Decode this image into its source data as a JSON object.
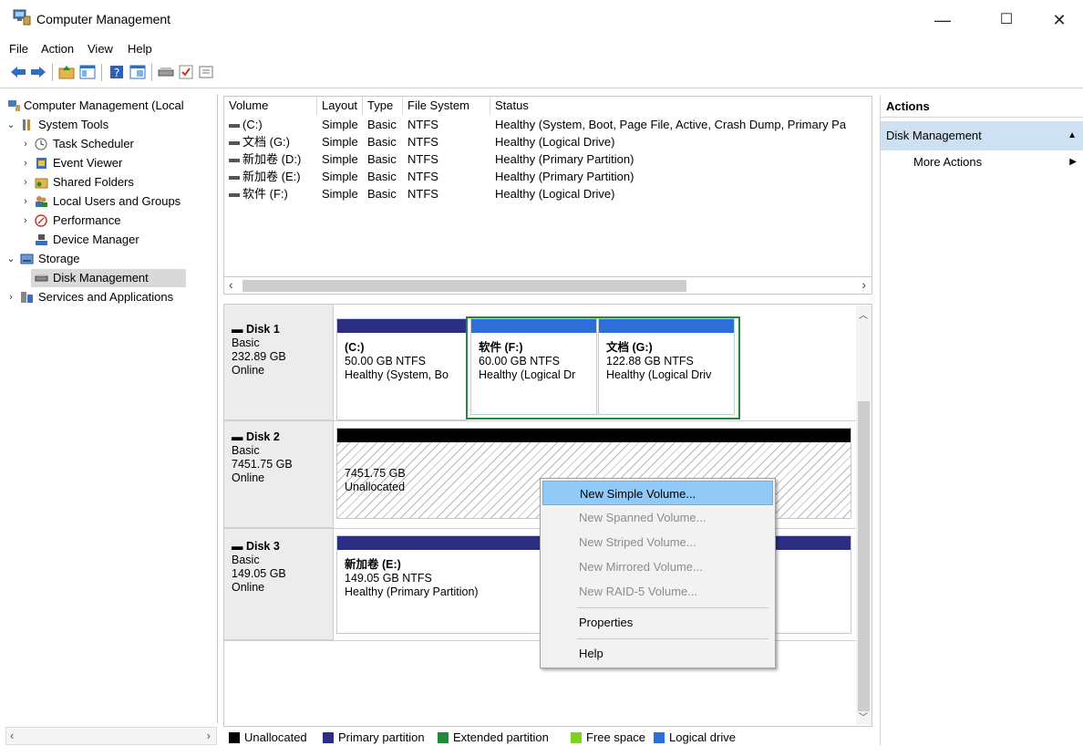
{
  "window": {
    "title": "Computer Management",
    "controls": {
      "minimize": "—",
      "maximize": "☐",
      "close": "✕"
    }
  },
  "menu": [
    "File",
    "Action",
    "View",
    "Help"
  ],
  "tree": {
    "root": "Computer Management (Local",
    "system_tools": "System Tools",
    "task_scheduler": "Task Scheduler",
    "event_viewer": "Event Viewer",
    "shared_folders": "Shared Folders",
    "local_users": "Local Users and Groups",
    "performance": "Performance",
    "device_manager": "Device Manager",
    "storage": "Storage",
    "disk_management": "Disk Management",
    "services": "Services and Applications"
  },
  "volume_list": {
    "headers": [
      "Volume",
      "Layout",
      "Type",
      "File System",
      "Status"
    ],
    "rows": [
      [
        "(C:)",
        "Simple",
        "Basic",
        "NTFS",
        "Healthy (System, Boot, Page File, Active, Crash Dump, Primary Pa"
      ],
      [
        "文档 (G:)",
        "Simple",
        "Basic",
        "NTFS",
        "Healthy (Logical Drive)"
      ],
      [
        "新加卷 (D:)",
        "Simple",
        "Basic",
        "NTFS",
        "Healthy (Primary Partition)"
      ],
      [
        "新加卷 (E:)",
        "Simple",
        "Basic",
        "NTFS",
        "Healthy (Primary Partition)"
      ],
      [
        "软件 (F:)",
        "Simple",
        "Basic",
        "NTFS",
        "Healthy (Logical Drive)"
      ]
    ]
  },
  "disks": {
    "d1": {
      "name": "Disk 1",
      "type": "Basic",
      "size": "232.89 GB",
      "status": "Online",
      "p_c": {
        "name": "(C:)",
        "size": "50.00 GB NTFS",
        "status": "Healthy (System, Bo"
      },
      "p_f": {
        "name": "软件 (F:)",
        "size": "60.00 GB NTFS",
        "status": "Healthy (Logical Dr"
      },
      "p_g": {
        "name": "文档 (G:)",
        "size": "122.88 GB NTFS",
        "status": "Healthy (Logical Driv"
      }
    },
    "d2": {
      "name": "Disk 2",
      "type": "Basic",
      "size": "7451.75 GB",
      "status": "Online",
      "p_u": {
        "size": "7451.75 GB",
        "status": "Unallocated"
      }
    },
    "d3": {
      "name": "Disk 3",
      "type": "Basic",
      "size": "149.05 GB",
      "status": "Online",
      "p_e": {
        "name": "新加卷 (E:)",
        "size": "149.05 GB NTFS",
        "status": "Healthy (Primary Partition)"
      }
    }
  },
  "legend": {
    "unallocated": "Unallocated",
    "primary": "Primary partition",
    "extended": "Extended partition",
    "free": "Free space",
    "logical": "Logical drive"
  },
  "colors": {
    "unallocated": "#000000",
    "primary": "#2b2e82",
    "extended": "#1e8a3a",
    "free": "#7ed321",
    "logical": "#2d6fd6"
  },
  "actions": {
    "header": "Actions",
    "section": "Disk Management",
    "more": "More Actions"
  },
  "context_menu": {
    "new_simple": "New Simple Volume...",
    "new_spanned": "New Spanned Volume...",
    "new_striped": "New Striped Volume...",
    "new_mirrored": "New Mirrored Volume...",
    "new_raid5": "New RAID-5 Volume...",
    "properties": "Properties",
    "help": "Help"
  }
}
